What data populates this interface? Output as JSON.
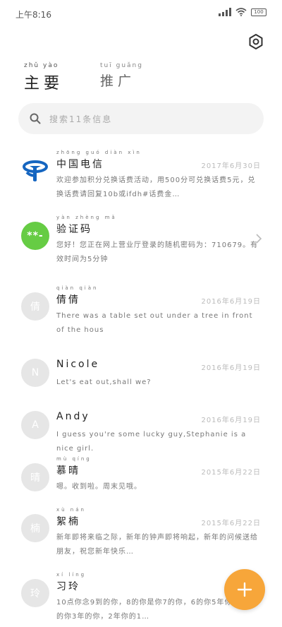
{
  "status": {
    "time": "上午8:16",
    "battery": "100"
  },
  "tabs": [
    {
      "label": "主要",
      "ruby": "zhǔ yào"
    },
    {
      "label": "推广",
      "ruby": "tuī guǎng"
    }
  ],
  "search": {
    "placeholder": "搜索11条信息"
  },
  "conversations": [
    {
      "name": "中国电信",
      "name_ruby": "zhōng guó diàn xìn",
      "date": "2017年6月30日",
      "snippet": "欢迎参加积分兑换话费活动，用500分可兑换话费5元，兑换话费请回复10b或ifdh#话费金…",
      "avatar_type": "telecom",
      "avatar_text": ""
    },
    {
      "name": "验证码",
      "name_ruby": "yàn zhèng mǎ",
      "date": "",
      "snippet": "您好！您正在网上营业厅登录的随机密码为：710679。有效时间为5分钟",
      "avatar_type": "green",
      "avatar_text": "**-"
    },
    {
      "name": "倩倩",
      "name_ruby": "qiàn qiàn",
      "date": "2016年6月19日",
      "snippet": "There was a table set out under a tree in front of the hous",
      "avatar_type": "gray",
      "avatar_text": "倩"
    },
    {
      "name": "Nicole",
      "name_ruby": "",
      "date": "2016年6月19日",
      "snippet": "Let's eat out,shall we?",
      "avatar_type": "gray",
      "avatar_text": "N"
    },
    {
      "name": "Andy",
      "name_ruby": "",
      "date": "2016年6月19日",
      "snippet": "I guess you're some lucky guy,Stephanie is a nice girl.",
      "avatar_type": "gray",
      "avatar_text": "A"
    },
    {
      "name": "慕晴",
      "name_ruby": "mù qíng",
      "date": "2015年6月22日",
      "snippet": "嗯。收到啦。周末见哦。",
      "avatar_type": "gray",
      "avatar_text": "晴"
    },
    {
      "name": "絮楠",
      "name_ruby": "xù nán",
      "date": "2015年6月22日",
      "snippet": "新年即将来临之际，新年的钟声即将响起，新年的问候送给朋友，祝您新年快乐…",
      "avatar_type": "gray",
      "avatar_text": "楠"
    },
    {
      "name": "习玲",
      "name_ruby": "xí líng",
      "date": "",
      "snippet": "10点你念9到的你，8的你是你7的你，6的你5年你你，4的你3年的你，2年你的1…",
      "avatar_type": "gray",
      "avatar_text": "玲"
    }
  ]
}
